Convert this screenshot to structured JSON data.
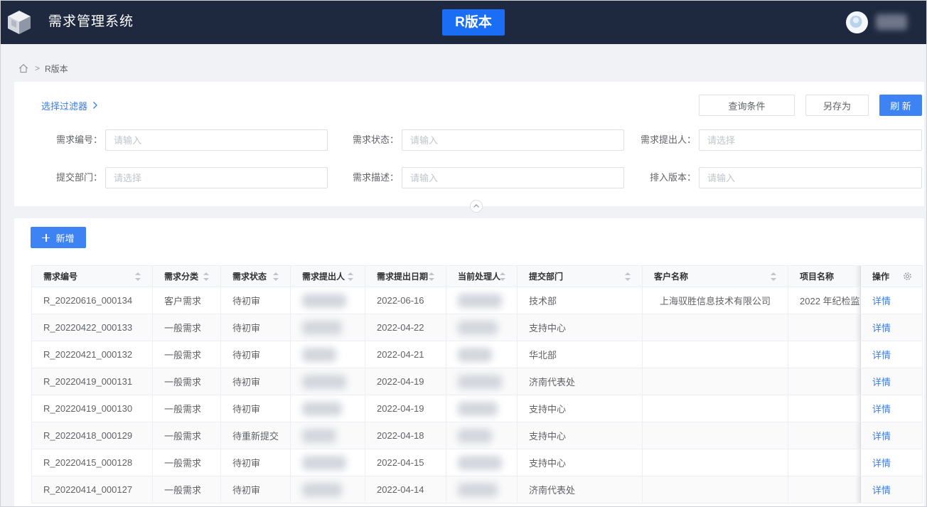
{
  "header": {
    "logo_icon": "cube-logo-icon",
    "title": "需求管理系统",
    "version_button": "R版本",
    "avatar_icon": "user-avatar-icon"
  },
  "breadcrumb": {
    "home_icon": "home-icon",
    "separator": ">",
    "current": "R版本"
  },
  "filter": {
    "selector_label": "选择过滤器",
    "selector_icon": "chevron-right-icon",
    "query_button": "查询条件",
    "save_as_button": "另存为",
    "refresh_button": "刷 新",
    "fields": [
      {
        "label": "需求编号：",
        "placeholder": "请输入"
      },
      {
        "label": "需求状态：",
        "placeholder": "请输入"
      },
      {
        "label": "需求提出人：",
        "placeholder": "请选择"
      },
      {
        "label": "提交部门：",
        "placeholder": "请选择"
      },
      {
        "label": "需求描述：",
        "placeholder": "请输入"
      },
      {
        "label": "排入版本：",
        "placeholder": "请输入"
      }
    ],
    "collapse_icon": "chevron-up-icon"
  },
  "table": {
    "add_icon": "plus-icon",
    "add_button": "新增",
    "columns": [
      {
        "label": "需求编号",
        "sortable": true
      },
      {
        "label": "需求分类",
        "sortable": true
      },
      {
        "label": "需求状态",
        "sortable": true
      },
      {
        "label": "需求提出人",
        "sortable": true,
        "blurred": true
      },
      {
        "label": "需求提出日期",
        "sortable": true
      },
      {
        "label": "当前处理人",
        "sortable": true,
        "blurred": true
      },
      {
        "label": "提交部门",
        "sortable": true
      },
      {
        "label": "客户名称",
        "sortable": true
      },
      {
        "label": "项目名称",
        "sortable": false
      },
      {
        "label": "操作",
        "sortable": false,
        "settings_icon": "gear-icon"
      }
    ],
    "rows": [
      [
        "R_20220616_000134",
        "客户需求",
        "待初审",
        null,
        "2022-06-16",
        null,
        "技术部",
        "上海驭胜信息技术有限公司",
        "2022 年纪检监",
        "详情"
      ],
      [
        "R_20220422_000133",
        "一般需求",
        "待初审",
        null,
        "2022-04-22",
        null,
        "支持中心",
        "",
        "",
        "详情"
      ],
      [
        "R_20220421_000132",
        "一般需求",
        "待初审",
        null,
        "2022-04-21",
        null,
        "华北部",
        "",
        "",
        "详情"
      ],
      [
        "R_20220419_000131",
        "一般需求",
        "待初审",
        null,
        "2022-04-19",
        null,
        "济南代表处",
        "",
        "",
        "详情"
      ],
      [
        "R_20220419_000130",
        "一般需求",
        "待初审",
        null,
        "2022-04-19",
        null,
        "支持中心",
        "",
        "",
        "详情"
      ],
      [
        "R_20220418_000129",
        "一般需求",
        "待重新提交",
        null,
        "2022-04-18",
        null,
        "支持中心",
        "",
        "",
        "详情"
      ],
      [
        "R_20220415_000128",
        "一般需求",
        "待初审",
        null,
        "2022-04-15",
        null,
        "支持中心",
        "",
        "",
        "详情"
      ],
      [
        "R_20220414_000127",
        "一般需求",
        "待初审",
        null,
        "2022-04-14",
        null,
        "济南代表处",
        "",
        "",
        "详情"
      ]
    ]
  },
  "colors": {
    "header_bg": "#1e2940",
    "primary": "#1a6ef5",
    "button_primary": "#3d83f3",
    "link": "#3a7de6",
    "page_bg": "#f0f2f5"
  }
}
